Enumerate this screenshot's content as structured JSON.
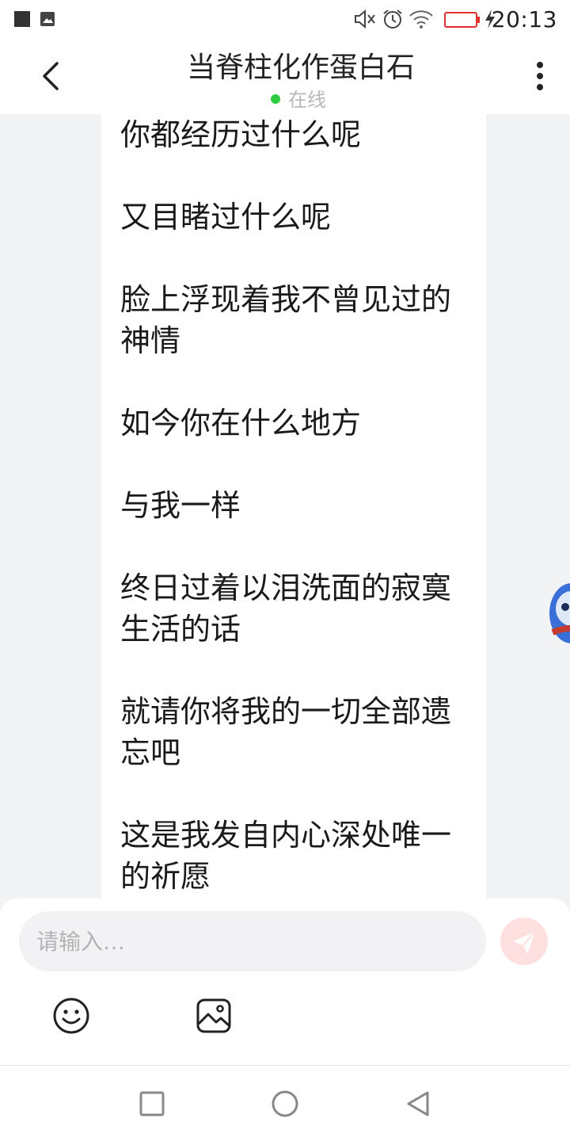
{
  "status_bar": {
    "time": "20:13",
    "icons": [
      "notification-square-icon",
      "image-notification-icon",
      "mute-icon",
      "alarm-icon",
      "wifi-icon",
      "battery-low-icon",
      "charging-icon"
    ],
    "battery_color": "#e03030"
  },
  "header": {
    "title": "当脊柱化作蛋白石",
    "status": "在线",
    "status_color": "#2ecc40"
  },
  "message": {
    "paragraphs": [
      "你都经历过什么呢",
      "又目睹过什么呢",
      "脸上浮现着我不曾见过的神情",
      "如今你在什么地方",
      "与我一样",
      "终日过着以泪洗面的寂寞生活的话",
      "就请你将我的一切全部遗忘吧",
      "这是我发自内心深处唯一的祈愿"
    ]
  },
  "composer": {
    "placeholder": "请输入…",
    "value": "",
    "send_icon": "send-icon",
    "tools": [
      "emoji-icon",
      "image-icon"
    ]
  },
  "nav": {
    "buttons": [
      "recent-apps-icon",
      "home-icon",
      "back-icon"
    ]
  }
}
